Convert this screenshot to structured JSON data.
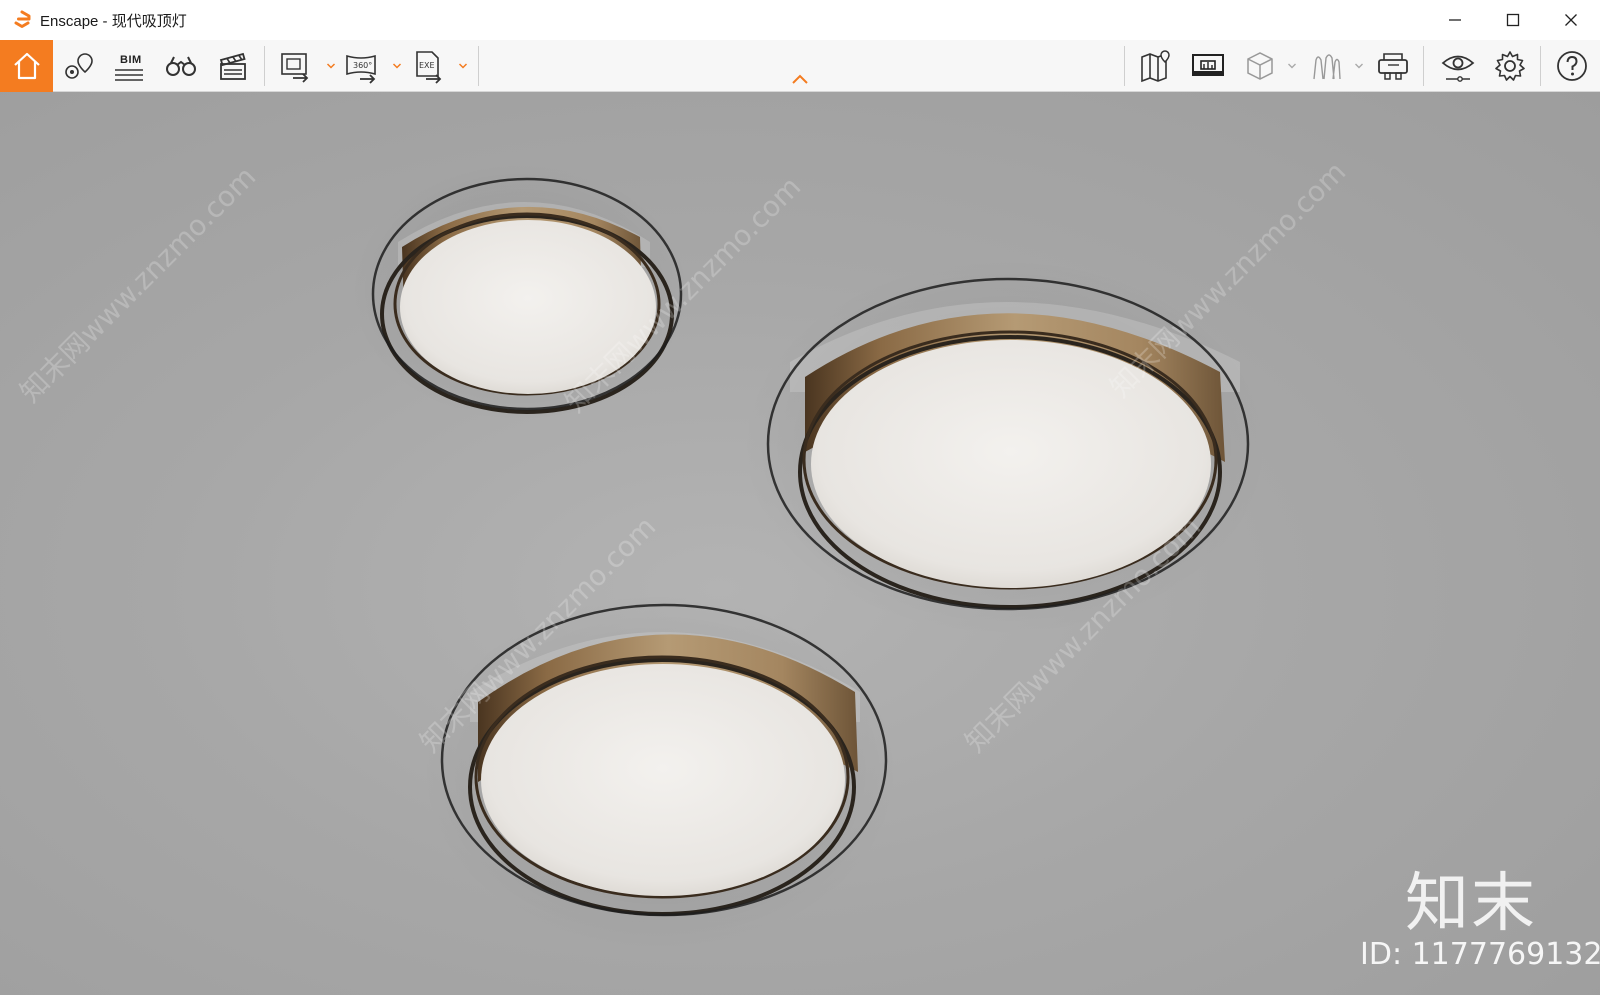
{
  "window": {
    "title": "Enscape - 现代吸顶灯",
    "minimize_icon": "minimize-icon",
    "maximize_icon": "maximize-icon",
    "close_icon": "close-icon",
    "logo_color": "#f47c20"
  },
  "toolbar": {
    "accent": "#f47c20",
    "bim_label": "BIM",
    "left_tools": [
      {
        "name": "home-button",
        "icon": "home-icon"
      },
      {
        "name": "views-button",
        "icon": "map-pin-icon"
      },
      {
        "name": "bim-button",
        "icon": "bim-icon"
      },
      {
        "name": "binoculars-button",
        "icon": "binoculars-icon"
      },
      {
        "name": "video-editor-button",
        "icon": "clapperboard-icon"
      },
      {
        "name": "export-image-button",
        "icon": "image-export-icon"
      },
      {
        "name": "export-panorama-button",
        "icon": "panorama-360-icon"
      },
      {
        "name": "export-exe-button",
        "icon": "exe-export-icon"
      }
    ],
    "right_tools": [
      {
        "name": "map-button",
        "icon": "map-icon"
      },
      {
        "name": "presentation-button",
        "icon": "monitor-icon"
      },
      {
        "name": "asset-library-button",
        "icon": "cube-icon"
      },
      {
        "name": "vr-button",
        "icon": "vr-headset-icon"
      },
      {
        "name": "visual-settings-button",
        "icon": "eye-icon"
      },
      {
        "name": "settings-button",
        "icon": "gear-icon"
      },
      {
        "name": "help-button",
        "icon": "help-icon"
      }
    ],
    "panorama_label": "360°",
    "exe_label": "EXE"
  },
  "viewport": {
    "watermark_logo": "知末",
    "watermark_id": "ID: 1177769132",
    "watermark_diagonal": "知末网www.znzmo.com"
  }
}
